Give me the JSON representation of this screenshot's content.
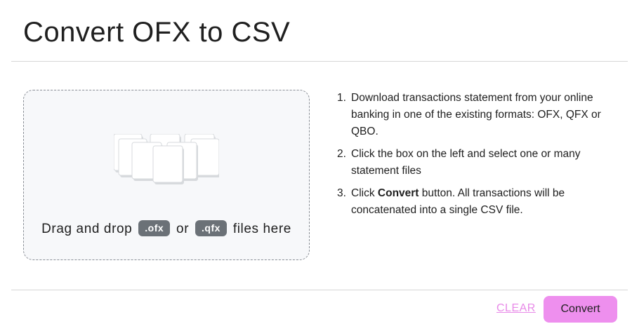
{
  "page": {
    "title": "Convert OFX to CSV"
  },
  "dropzone": {
    "prefix": "Drag and drop",
    "badge_ofx": ".ofx",
    "middle": "or",
    "badge_qfx": ".qfx",
    "suffix": "files here",
    "icon": "files-stack-icon"
  },
  "instructions": {
    "steps": [
      {
        "number": "1.",
        "text": "Download transactions statement from your online banking in one of the existing formats: OFX, QFX or QBO."
      },
      {
        "number": "2.",
        "text": "Click the box on the left and select one or many statement files"
      },
      {
        "number": "3.",
        "before": "Click",
        "bold": "Convert",
        "after": "button. All transactions will be concatenated into a single CSV file."
      }
    ]
  },
  "footer": {
    "clear_label": "CLEAR",
    "convert_label": "Convert"
  },
  "colors": {
    "accent": "#ee8fee",
    "link": "#e88ae8",
    "badge": "#6b7177",
    "dropzone_bg": "#f7f8fa"
  }
}
